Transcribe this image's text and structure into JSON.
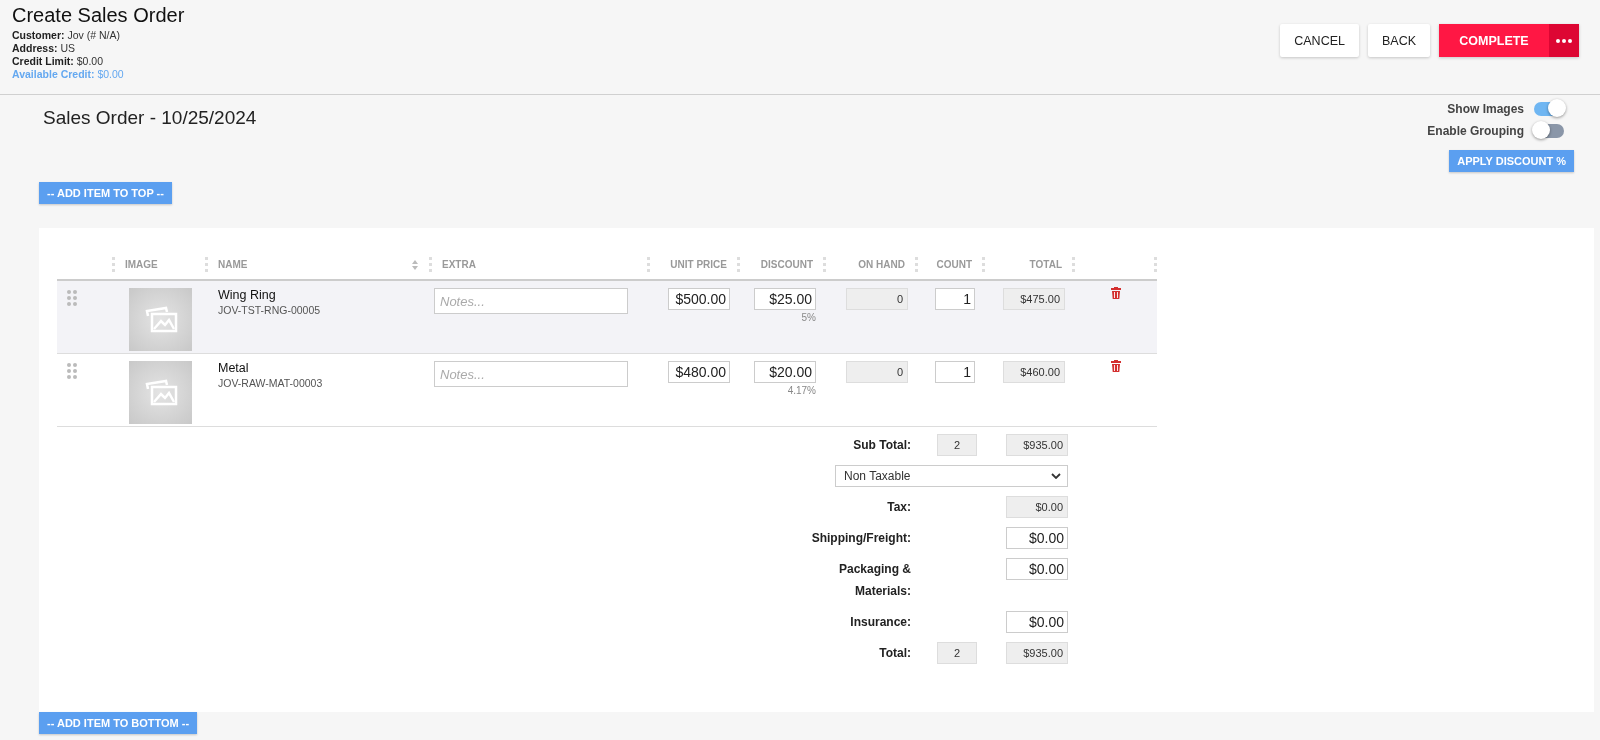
{
  "header": {
    "title": "Create Sales Order",
    "info": [
      {
        "label": "Customer:",
        "value": "Jov (# N/A)",
        "kind": "normal"
      },
      {
        "label": "Address:",
        "value": "US",
        "kind": "normal"
      },
      {
        "label": "Credit Limit:",
        "value": "$0.00",
        "kind": "normal"
      },
      {
        "label": "Available Credit:",
        "value": "$0.00",
        "kind": "highlight"
      }
    ],
    "buttons": [
      {
        "label": "CANCEL",
        "kind": "plain"
      },
      {
        "label": "BACK",
        "kind": "plain"
      },
      {
        "label": "COMPLETE",
        "kind": "primary"
      }
    ]
  },
  "order": {
    "title": "Sales Order - 10/25/2024",
    "toggles": [
      {
        "label": "Show Images",
        "on": true
      },
      {
        "label": "Enable Grouping",
        "on": false
      }
    ],
    "apply_discount": "APPLY DISCOUNT %",
    "add_top": "-- ADD ITEM TO TOP --",
    "add_bottom": "-- ADD ITEM TO BOTTOM --"
  },
  "table": {
    "columns": [
      {
        "label": "IMAGE",
        "sortable": false
      },
      {
        "label": "NAME",
        "sortable": true
      },
      {
        "label": "EXTRA",
        "sortable": false
      },
      {
        "label": "UNIT PRICE",
        "sortable": false
      },
      {
        "label": "DISCOUNT",
        "sortable": false
      },
      {
        "label": "ON HAND",
        "sortable": false
      },
      {
        "label": "COUNT",
        "sortable": false
      },
      {
        "label": "TOTAL",
        "sortable": false
      }
    ],
    "rows": [
      {
        "name": "Wing Ring",
        "sku": "JOV-TST-RNG-00005",
        "notes_placeholder": "Notes...",
        "unit_price": "$500.00",
        "discount": "$25.00",
        "discount_percent": "5%",
        "on_hand": "0",
        "count": "1",
        "total": "$475.00",
        "selected": true
      },
      {
        "name": "Metal",
        "sku": "JOV-RAW-MAT-00003",
        "notes_placeholder": "Notes...",
        "unit_price": "$480.00",
        "discount": "$20.00",
        "discount_percent": "4.17%",
        "on_hand": "0",
        "count": "1",
        "total": "$460.00",
        "selected": false
      }
    ],
    "summary": [
      {
        "kind": "totals",
        "label": "Sub Total:",
        "count": "2",
        "value": "$935.00"
      },
      {
        "kind": "select",
        "value": "Non Taxable"
      },
      {
        "kind": "readonly",
        "label": "Tax:",
        "value": "$0.00"
      },
      {
        "kind": "input",
        "label": "Shipping/Freight:",
        "value": "$0.00"
      },
      {
        "kind": "input",
        "label": "Packaging & Materials:",
        "value": "$0.00"
      },
      {
        "kind": "input",
        "label": "Insurance:",
        "value": "$0.00"
      },
      {
        "kind": "totals",
        "label": "Total:",
        "count": "2",
        "value": "$935.00"
      }
    ]
  }
}
